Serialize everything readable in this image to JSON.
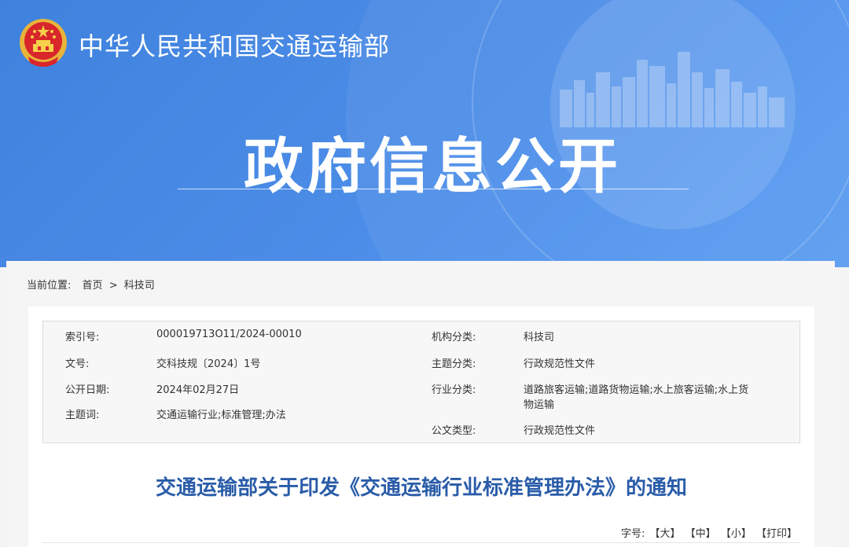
{
  "header": {
    "ministry_name": "中华人民共和国交通运输部",
    "section_title": "政府信息公开"
  },
  "breadcrumb": {
    "prefix": "当前位置:",
    "home": "首页",
    "separator": ">",
    "current": "科技司"
  },
  "meta": {
    "index_label": "索引号:",
    "index_value": "000019713O11/2024-00010",
    "doc_no_label": "文号:",
    "doc_no_value": "交科技规〔2024〕1号",
    "pub_date_label": "公开日期:",
    "pub_date_value": "2024年02月27日",
    "keywords_label": "主题词:",
    "keywords_value": "交通运输行业;标准管理;办法",
    "org_label": "机构分类:",
    "org_value": "科技司",
    "topic_label": "主题分类:",
    "topic_value": "行政规范性文件",
    "industry_label": "行业分类:",
    "industry_value_line1": "道路旅客运输;道路货物运输;水上旅客运输;水上货",
    "industry_value_line2": "物运输",
    "doctype_label": "公文类型:",
    "doctype_value": "行政规范性文件"
  },
  "document": {
    "title": "交通运输部关于印发《交通运输行业标准管理办法》的通知"
  },
  "font_size_bar": {
    "label": "字号:",
    "large": "【大】",
    "medium": "【中】",
    "small": "【小】",
    "print": "【打印】"
  },
  "colors": {
    "banner_blue": "#4a8be6",
    "title_blue": "#2a5ca8"
  }
}
